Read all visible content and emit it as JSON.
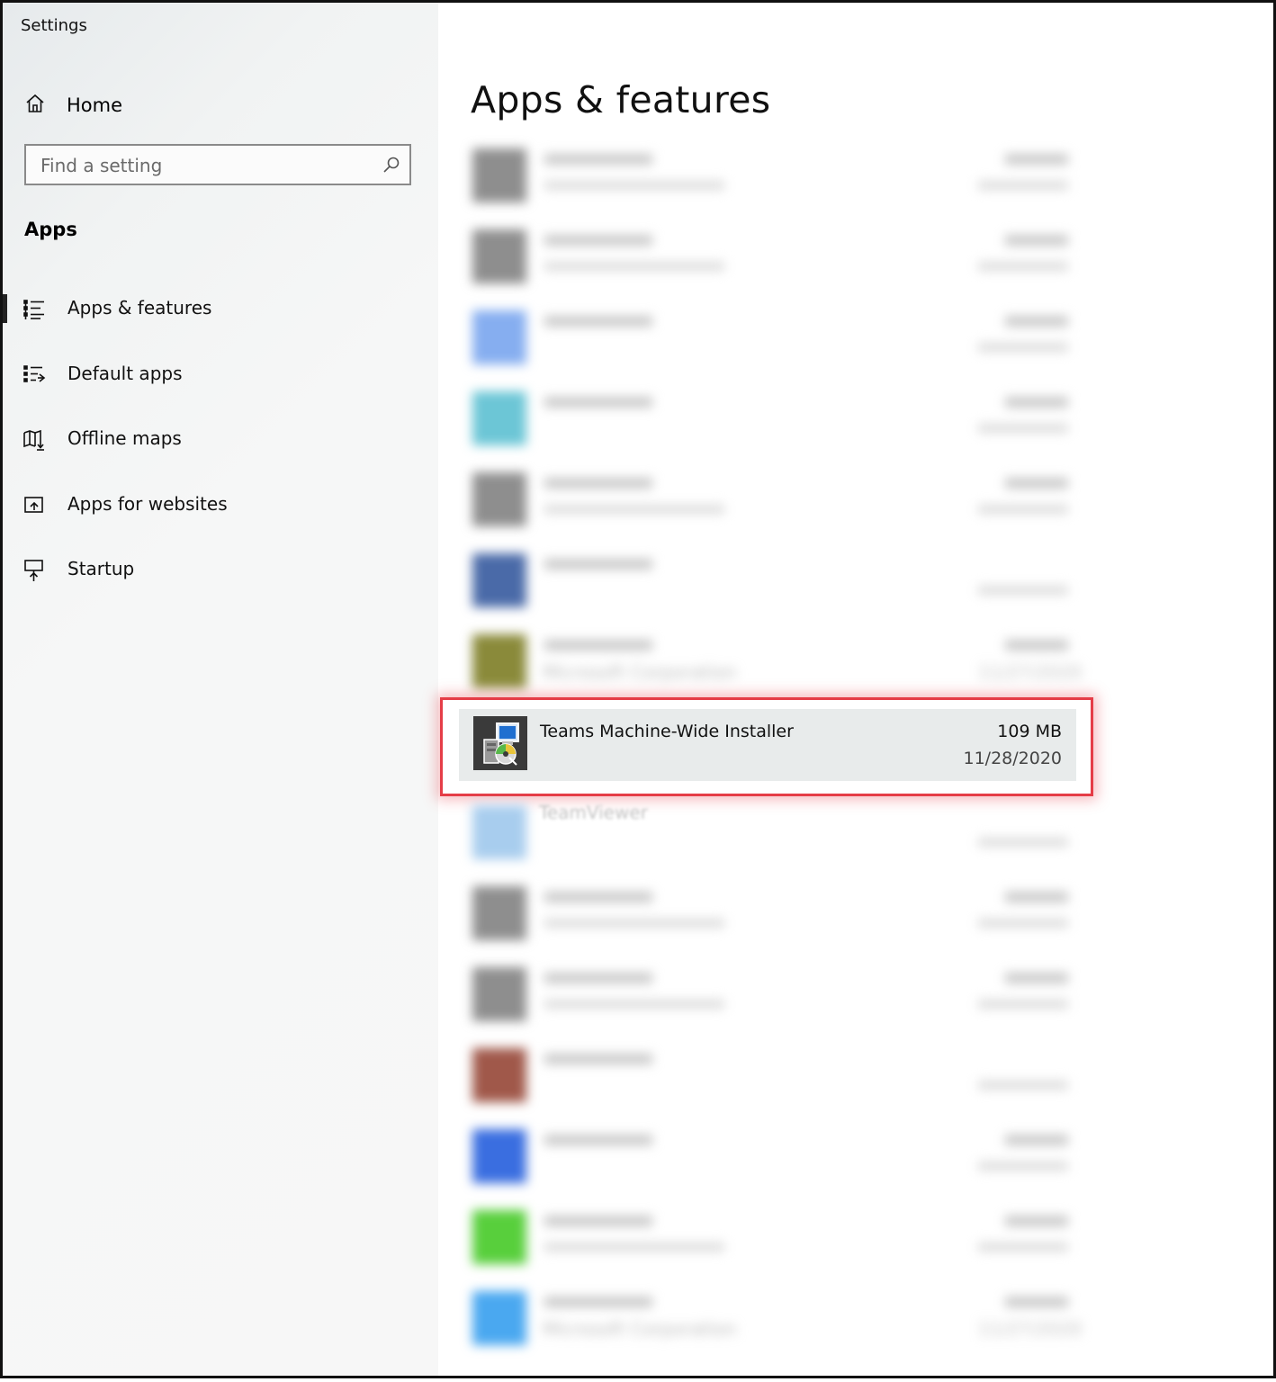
{
  "window": {
    "title": "Settings"
  },
  "sidebar": {
    "home_label": "Home",
    "search": {
      "placeholder": "Find a setting",
      "value": ""
    },
    "section_title": "Apps",
    "items": [
      {
        "label": "Apps & features",
        "icon": "apps-features-icon",
        "selected": true
      },
      {
        "label": "Default apps",
        "icon": "default-apps-icon",
        "selected": false
      },
      {
        "label": "Offline maps",
        "icon": "offline-maps-icon",
        "selected": false
      },
      {
        "label": "Apps for websites",
        "icon": "apps-websites-icon",
        "selected": false
      },
      {
        "label": "Startup",
        "icon": "startup-icon",
        "selected": false
      }
    ]
  },
  "main": {
    "title": "Apps & features",
    "blurred_rows": [
      {
        "icon_color": "#8e8e8e"
      },
      {
        "icon_color": "#8e8e8e"
      },
      {
        "icon_color": "#86aef0"
      },
      {
        "icon_color": "#6cc6d6"
      },
      {
        "icon_color": "#8e8e8e"
      },
      {
        "icon_color": "#4a6aa8"
      },
      {
        "icon_color": "#8a8a3a",
        "publisher": "Microsoft Corporation",
        "date": "11/27/2020"
      }
    ],
    "highlighted_app": {
      "name": "Teams Machine-Wide Installer",
      "size": "109 MB",
      "date": "11/28/2020",
      "icon": "installer-icon"
    },
    "next_app_name": "TeamViewer",
    "blurred_rows_after": [
      {
        "icon_color": "#a8cdee"
      },
      {
        "icon_color": "#8e8e8e"
      },
      {
        "icon_color": "#8e8e8e"
      },
      {
        "icon_color": "#a0584a"
      },
      {
        "icon_color": "#3a6ee0"
      },
      {
        "icon_color": "#58cf3c"
      },
      {
        "icon_color": "#4aa8f0",
        "publisher": "Microsoft Corporation",
        "date": "11/27/2020"
      }
    ],
    "accent_color": "#e53d47"
  }
}
